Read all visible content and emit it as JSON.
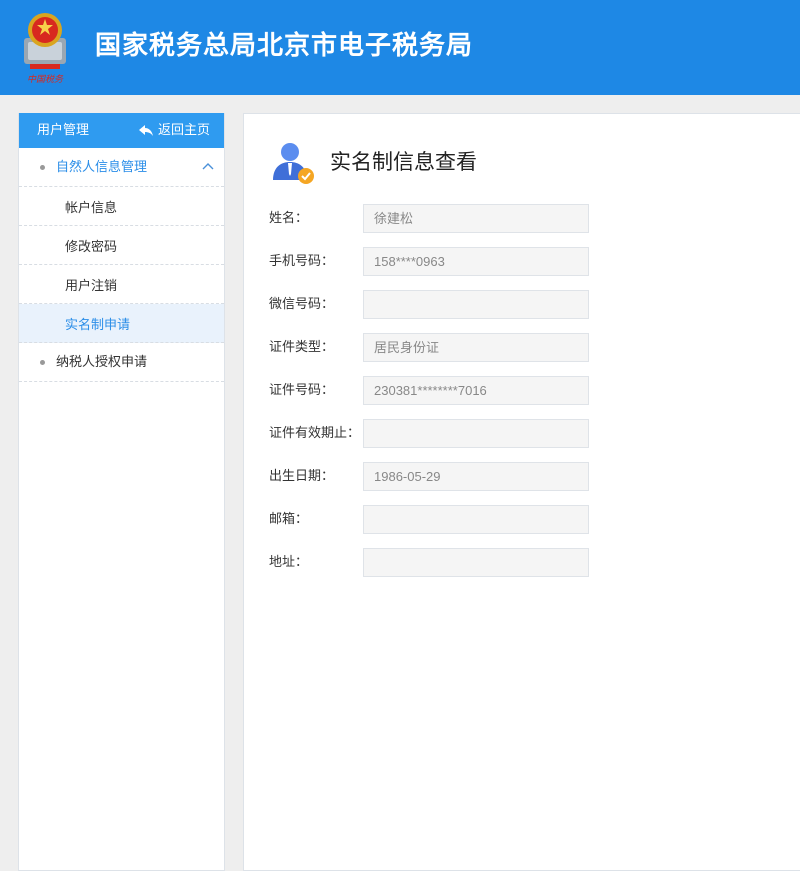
{
  "header": {
    "site_title": "国家税务总局北京市电子税务局",
    "bg_color": "#1e88e5",
    "emblem_caption": "中国税务"
  },
  "sidebar": {
    "title": "用户管理",
    "back_label": "返回主页",
    "groups": [
      {
        "label": "自然人信息管理",
        "expanded": true,
        "items": [
          {
            "label": "帐户信息",
            "active": false
          },
          {
            "label": "修改密码",
            "active": false
          },
          {
            "label": "用户注销",
            "active": false
          },
          {
            "label": "实名制申请",
            "active": true
          }
        ]
      },
      {
        "label": "纳税人授权申请",
        "expanded": false,
        "items": []
      }
    ]
  },
  "main": {
    "page_title": "实名制信息查看",
    "fields": [
      {
        "label": "姓名：",
        "value": "徐建松"
      },
      {
        "label": "手机号码：",
        "value": "158****0963"
      },
      {
        "label": "微信号码：",
        "value": ""
      },
      {
        "label": "证件类型：",
        "value": "居民身份证"
      },
      {
        "label": "证件号码：",
        "value": "230381********7016"
      },
      {
        "label": "证件有效期止：",
        "value": ""
      },
      {
        "label": "出生日期：",
        "value": "1986-05-29"
      },
      {
        "label": "邮箱：",
        "value": ""
      },
      {
        "label": "地址：",
        "value": ""
      }
    ]
  },
  "colors": {
    "accent": "#2b8ee8",
    "sidebar_head": "#2f9bf0",
    "active_bg": "#e9f2fc"
  }
}
